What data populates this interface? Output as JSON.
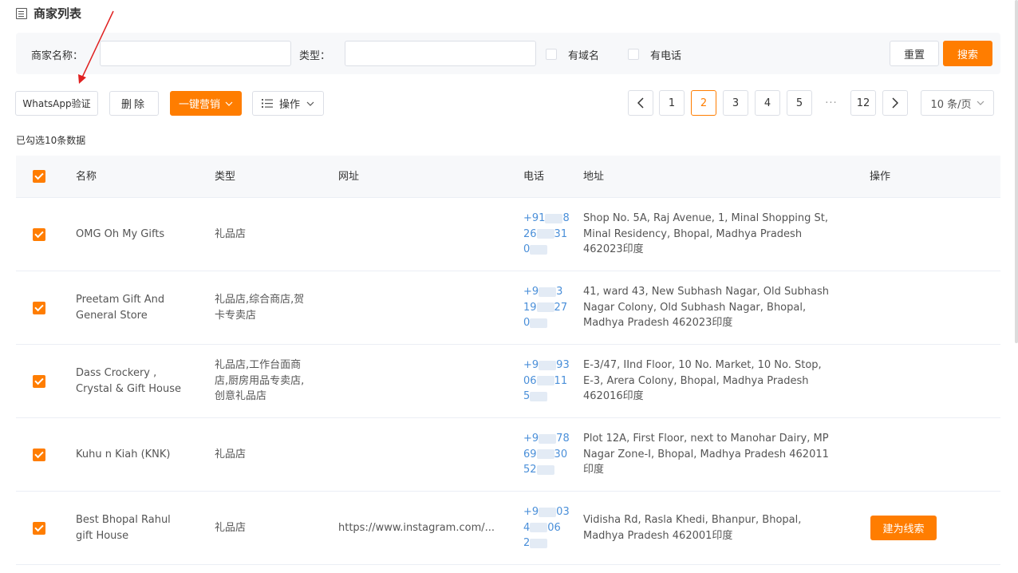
{
  "page": {
    "title": "商家列表"
  },
  "filters": {
    "name_label": "商家名称：",
    "name_value": "",
    "type_label": "类型：",
    "type_value": "",
    "has_domain_label": "有域名",
    "has_phone_label": "有电话",
    "reset_label": "重置",
    "search_label": "搜索"
  },
  "toolbar": {
    "whatsapp_label": "WhatsApp验证",
    "delete_label": "删除",
    "marketing_label": "一键营销",
    "actions_label": "操作"
  },
  "pagination": {
    "pages": [
      "1",
      "2",
      "3",
      "4",
      "5",
      "12"
    ],
    "current": "2",
    "ellipsis": "···",
    "page_size": "10 条/页"
  },
  "selected_info": "已勾选10条数据",
  "table": {
    "headers": {
      "name": "名称",
      "type": "类型",
      "url": "网址",
      "phone": "电话",
      "address": "地址",
      "action": "操作"
    },
    "rows": [
      {
        "name": [
          "OMG Oh My Gifts"
        ],
        "type": [
          "礼品店"
        ],
        "url": "",
        "phone": [
          "+91",
          "8",
          "26",
          "31",
          "0",
          ""
        ],
        "address": [
          "Shop No. 5A, Raj Avenue, 1, Minal Shopping St,",
          "Minal Residency, Bhopal, Madhya Pradesh",
          "462023印度"
        ],
        "action": ""
      },
      {
        "name": [
          "Preetam Gift And",
          "General Store"
        ],
        "type": [
          "礼品店,综合商店,贺",
          "卡专卖店"
        ],
        "url": "",
        "phone": [
          "+9",
          "3",
          "19",
          "27",
          "0",
          ""
        ],
        "address": [
          "41, ward 43, New Subhash Nagar, Old Subhash",
          "Nagar Colony, Old Subhash Nagar, Bhopal,",
          "Madhya Pradesh 462023印度"
        ],
        "action": ""
      },
      {
        "name": [
          "Dass Crockery ,",
          "Crystal & Gift House"
        ],
        "type": [
          "礼品店,工作台面商",
          "店,厨房用品专卖店,",
          "创意礼品店"
        ],
        "url": "",
        "phone": [
          "+9",
          "93",
          "06",
          "11",
          "5",
          ""
        ],
        "address": [
          "E-3/47, IInd Floor, 10 No. Market, 10 No. Stop,",
          "E-3, Arera Colony, Bhopal, Madhya Pradesh",
          "462016印度"
        ],
        "action": ""
      },
      {
        "name": [
          "Kuhu n Kiah (KNK)"
        ],
        "type": [
          "礼品店"
        ],
        "url": "",
        "phone": [
          "+9",
          "78",
          "69",
          "30",
          "52",
          ""
        ],
        "address": [
          "Plot 12A, First Floor, next to Manohar Dairy, MP",
          "Nagar Zone-I, Bhopal, Madhya Pradesh 462011",
          "印度"
        ],
        "action": ""
      },
      {
        "name": [
          "Best Bhopal Rahul",
          "gift House"
        ],
        "type": [
          "礼品店"
        ],
        "url": "https://www.instagram.com/...",
        "phone": [
          "+9",
          "03",
          "4",
          "06",
          "2",
          ""
        ],
        "address": [
          "Vidisha Rd, Rasla Khedi, Bhanpur, Bhopal,",
          "Madhya Pradesh 462001印度"
        ],
        "action": "建为线索"
      }
    ]
  },
  "colors": {
    "accent": "#ff7d00",
    "phone": "#4a8fd9",
    "arrow": "#e02020"
  }
}
